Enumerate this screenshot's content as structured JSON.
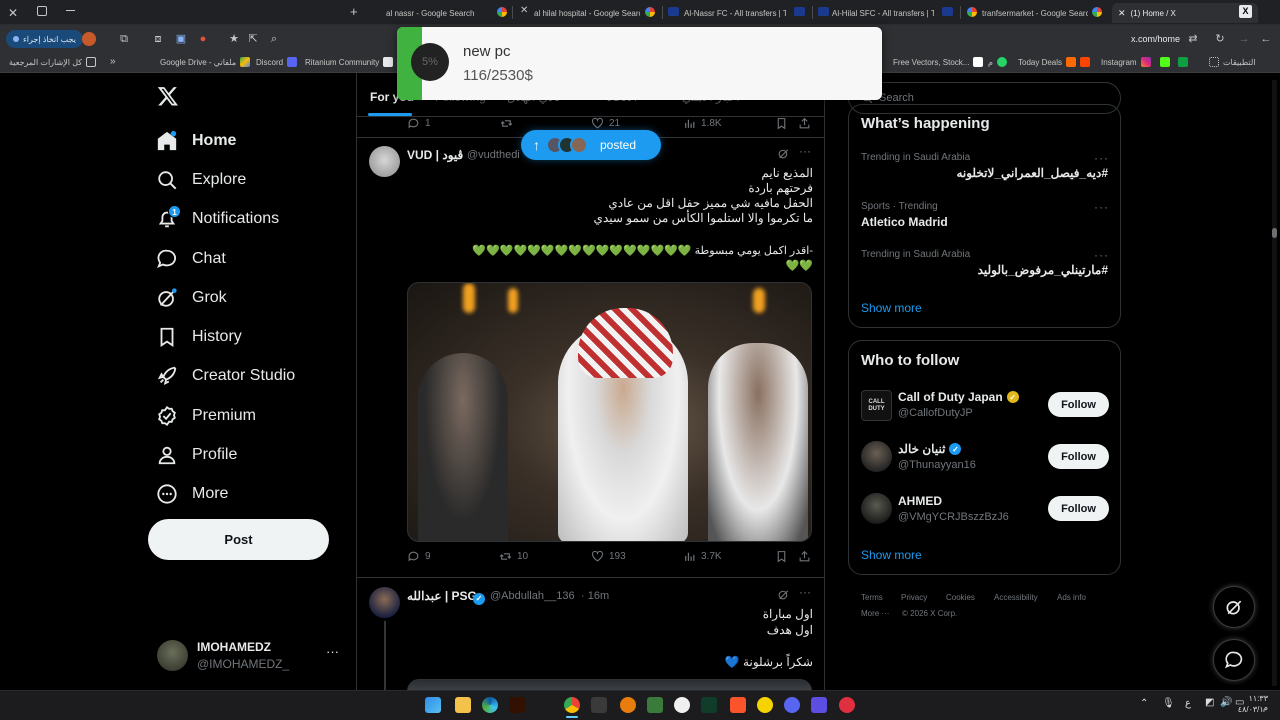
{
  "browser": {
    "tabs": [
      {
        "title": "al nassr - Google Search"
      },
      {
        "title": "al hilal hospital - Google Search"
      },
      {
        "title": "Al-Nassr FC - All transfers | Tra"
      },
      {
        "title": "Al-Hilal SFC - All transfers | Tra"
      },
      {
        "title": "tranfsermarket - Google Search"
      },
      {
        "title": "(1) Home / X"
      }
    ],
    "url": "x.com/home",
    "action_chip": "يجب اتخاذ إجراء",
    "bookmarks": {
      "all_bookmarks": "كل الإشارات المرجعية",
      "google_drive": "Google Drive - ملفاتي",
      "discord": "Discord",
      "ritanium": "Ritanium Community",
      "free_vectors": "Free Vectors, Stock...",
      "today_deals": "Today Deals",
      "instagram": "Instagram",
      "apps": "التطبيقات",
      "misc_r": "م",
      "misc_t": "ت"
    }
  },
  "overlay": {
    "percent": "5%",
    "title": "new pc",
    "amount": "116/2530$",
    "accent": "#3fb23f"
  },
  "nav": {
    "home": "Home",
    "explore": "Explore",
    "notifications": "Notifications",
    "notif_badge": "1",
    "chat": "Chat",
    "grok": "Grok",
    "history": "History",
    "creator_studio": "Creator Studio",
    "premium": "Premium",
    "profile": "Profile",
    "more": "More",
    "post": "Post"
  },
  "account": {
    "name": "IMOHAMEDZ",
    "handle": "@IMOHAMEDZ_"
  },
  "feed": {
    "tabs": {
      "for_you": "For you",
      "following": "Following",
      "arabic_1": "نادي الهلال",
      "arabic_2": "الاتحاد",
      "arabic_3": "اخبار الاهلي"
    },
    "new_posts_pill": "posted",
    "prev_post": {
      "replies": "1",
      "likes": "21",
      "views": "1.8K"
    },
    "post1": {
      "name": "VUD | ڤيود",
      "handle": "@vudthedi",
      "lines": [
        "المذيع نايم",
        "فرحتهم باردة",
        "الحفل مافيه شي مميز حفل اقل من عادي",
        "ما تكرموا والا استلموا الكأس من سمو سيدي"
      ],
      "line5": "-اقدر اكمل يومي مبسوطة 💚💚💚💚💚💚💚💚💚💚💚💚💚💚💚💚",
      "line6": "💚💚",
      "replies": "9",
      "reposts": "10",
      "likes": "193",
      "views": "3.7K"
    },
    "post2": {
      "name": "عبدالله | PSG",
      "handle": "@Abdullah__136",
      "time": "· 16m",
      "lines": [
        "اول مباراة",
        "اول هدف"
      ],
      "line3": "شكراً برشلونة 💙"
    }
  },
  "right": {
    "search_placeholder": "Search",
    "whats_happening": "What’s happening",
    "trends": [
      {
        "meta": "Trending in Saudi Arabia",
        "title": "#ديه_فيصل_العمراني_لاتخلونه"
      },
      {
        "meta": "Sports · Trending",
        "title": "Atletico Madrid"
      },
      {
        "meta": "Trending in Saudi Arabia",
        "title": "#مارتينلي_مرفوض_بالوليد"
      }
    ],
    "show_more": "Show more",
    "who_to_follow": "Who to follow",
    "follow_suggestions": [
      {
        "name": "Call of Duty Japan",
        "handle": "@CallofDutyJP",
        "button": "Follow",
        "badge_color": "#e2b719"
      },
      {
        "name": "ثنيان خالد",
        "handle": "@Thunayyan16",
        "button": "Follow",
        "badge_color": "#1d9bf0"
      },
      {
        "name": "AHMED",
        "handle": "@VMgYCRJBszzBzJ6",
        "button": "Follow",
        "badge_color": ""
      }
    ],
    "show_more_2": "Show more",
    "footer": {
      "terms": "Terms",
      "privacy": "Privacy",
      "cookies": "Cookies",
      "accessibility": "Accessibility",
      "ads_info": "Ads info",
      "more": "More ···",
      "copyright": "© 2026 X Corp."
    }
  },
  "taskbar": {
    "clock_time": "١١:٣٣ م",
    "clock_date": "٤٨/٠٣/١٠",
    "lang": "ع"
  },
  "colors": {
    "x_blue": "#1d9bf0",
    "background": "#000000",
    "border": "#2f3336",
    "muted": "#71767b"
  }
}
